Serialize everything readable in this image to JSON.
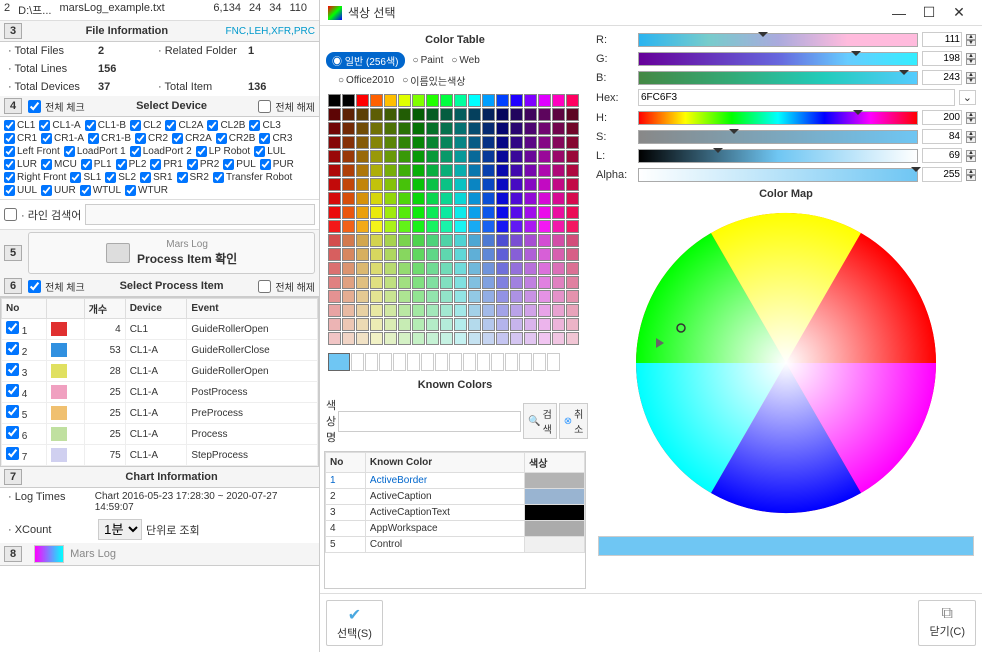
{
  "top": {
    "idx": "2",
    "path": "D:\\프...",
    "file": "marsLog_example.txt",
    "c1": "6,134",
    "c2": "24",
    "c3": "34",
    "c4": "110"
  },
  "fileInfo": {
    "sectionNum": "3",
    "title": "File Information",
    "types": "FNC,LEH,XFR,PRC",
    "labels": {
      "totalFiles": "· Total Files",
      "relatedFolder": "· Related Folder",
      "totalLines": "· Total Lines",
      "totalDevices": "· Total Devices",
      "totalItem": "· Total Item"
    },
    "values": {
      "totalFiles": "2",
      "relatedFolder": "1",
      "totalLines": "156",
      "totalDevices": "37",
      "totalItem": "136"
    }
  },
  "deviceSection": {
    "sectionNum": "4",
    "checkAll": "전체 체크",
    "title": "Select Device",
    "uncheckAll": "전체 해제",
    "devices": [
      "CL1",
      "CL1-A",
      "CL1-B",
      "CL2",
      "CL2A",
      "CL2B",
      "CL3",
      "CR1",
      "CR1-A",
      "CR1-B",
      "CR2",
      "CR2A",
      "CR2B",
      "CR3",
      "Left Front",
      "LoadPort 1",
      "LoadPort 2",
      "LP Robot",
      "LUL",
      "LUR",
      "MCU",
      "PL1",
      "PL2",
      "PR1",
      "PR2",
      "PUL",
      "PUR",
      "Right Front",
      "SL1",
      "SL2",
      "SR1",
      "SR2",
      "Transfer Robot",
      "UUL",
      "UUR",
      "WTUL",
      "WTUR"
    ]
  },
  "search": {
    "label": "· 라인 검색어"
  },
  "marsLog": {
    "sectionNum": "5",
    "sub": "Mars Log",
    "main": "Process Item 확인"
  },
  "processSection": {
    "sectionNum": "6",
    "checkAll": "전체 체크",
    "title": "Select Process Item",
    "uncheckAll": "전체 해제",
    "headers": {
      "no": "No",
      "count": "개수",
      "device": "Device",
      "event": "Event"
    },
    "rows": [
      {
        "no": "1",
        "color": "#e03030",
        "count": "4",
        "device": "CL1",
        "event": "GuideRollerOpen"
      },
      {
        "no": "2",
        "color": "#3090e0",
        "count": "53",
        "device": "CL1-A",
        "event": "GuideRollerClose"
      },
      {
        "no": "3",
        "color": "#e0e060",
        "count": "28",
        "device": "CL1-A",
        "event": "GuideRollerOpen"
      },
      {
        "no": "4",
        "color": "#f0a0c0",
        "count": "25",
        "device": "CL1-A",
        "event": "PostProcess"
      },
      {
        "no": "5",
        "color": "#f0c070",
        "count": "25",
        "device": "CL1-A",
        "event": "PreProcess"
      },
      {
        "no": "6",
        "color": "#c0e0a0",
        "count": "25",
        "device": "CL1-A",
        "event": "Process"
      },
      {
        "no": "7",
        "color": "#d0d0f0",
        "count": "75",
        "device": "CL1-A",
        "event": "StepProcess"
      }
    ]
  },
  "chartInfo": {
    "sectionNum": "7",
    "title": "Chart Information",
    "logTimesLabel": "· Log Times",
    "logTimesValue": "Chart 2016-05-23 17:28:30 ~ 2020-07-27 14:59:07",
    "xCountLabel": "· XCount",
    "xCountValue": "1분",
    "xCountUnit": "단위로 조회"
  },
  "section8": {
    "sectionNum": "8",
    "label": "Mars Log"
  },
  "dialog": {
    "title": "색상 선택",
    "colorTable": "Color Table",
    "radios": {
      "normal": "일반 (256색)",
      "paint": "Paint",
      "web": "Web",
      "office": "Office2010",
      "named": "이름있는색상"
    },
    "knownColors": {
      "title": "Known Colors",
      "searchLabel": "색상명",
      "searchBtn": "검색",
      "cancelBtn": "취소",
      "headers": {
        "no": "No",
        "name": "Known Color",
        "color": "색상"
      },
      "rows": [
        {
          "no": "1",
          "name": "ActiveBorder",
          "color": "#b4b4b4"
        },
        {
          "no": "2",
          "name": "ActiveCaption",
          "color": "#99b4d1"
        },
        {
          "no": "3",
          "name": "ActiveCaptionText",
          "color": "#000000"
        },
        {
          "no": "4",
          "name": "AppWorkspace",
          "color": "#ababab"
        },
        {
          "no": "5",
          "name": "Control",
          "color": "#f0f0f0"
        }
      ]
    },
    "sliders": {
      "r": {
        "label": "R:",
        "val": "111"
      },
      "g": {
        "label": "G:",
        "val": "198"
      },
      "b": {
        "label": "B:",
        "val": "243"
      },
      "h": {
        "label": "H:",
        "val": "200"
      },
      "s": {
        "label": "S:",
        "val": "84"
      },
      "l": {
        "label": "L:",
        "val": "69"
      },
      "alpha": {
        "label": "Alpha:",
        "val": "255"
      }
    },
    "hex": {
      "label": "Hex:",
      "val": "6FC6F3"
    },
    "colorMap": "Color Map",
    "selectBtn": "선택(S)",
    "closeBtn": "닫기(C)",
    "previewColor": "#6FC6F3"
  }
}
